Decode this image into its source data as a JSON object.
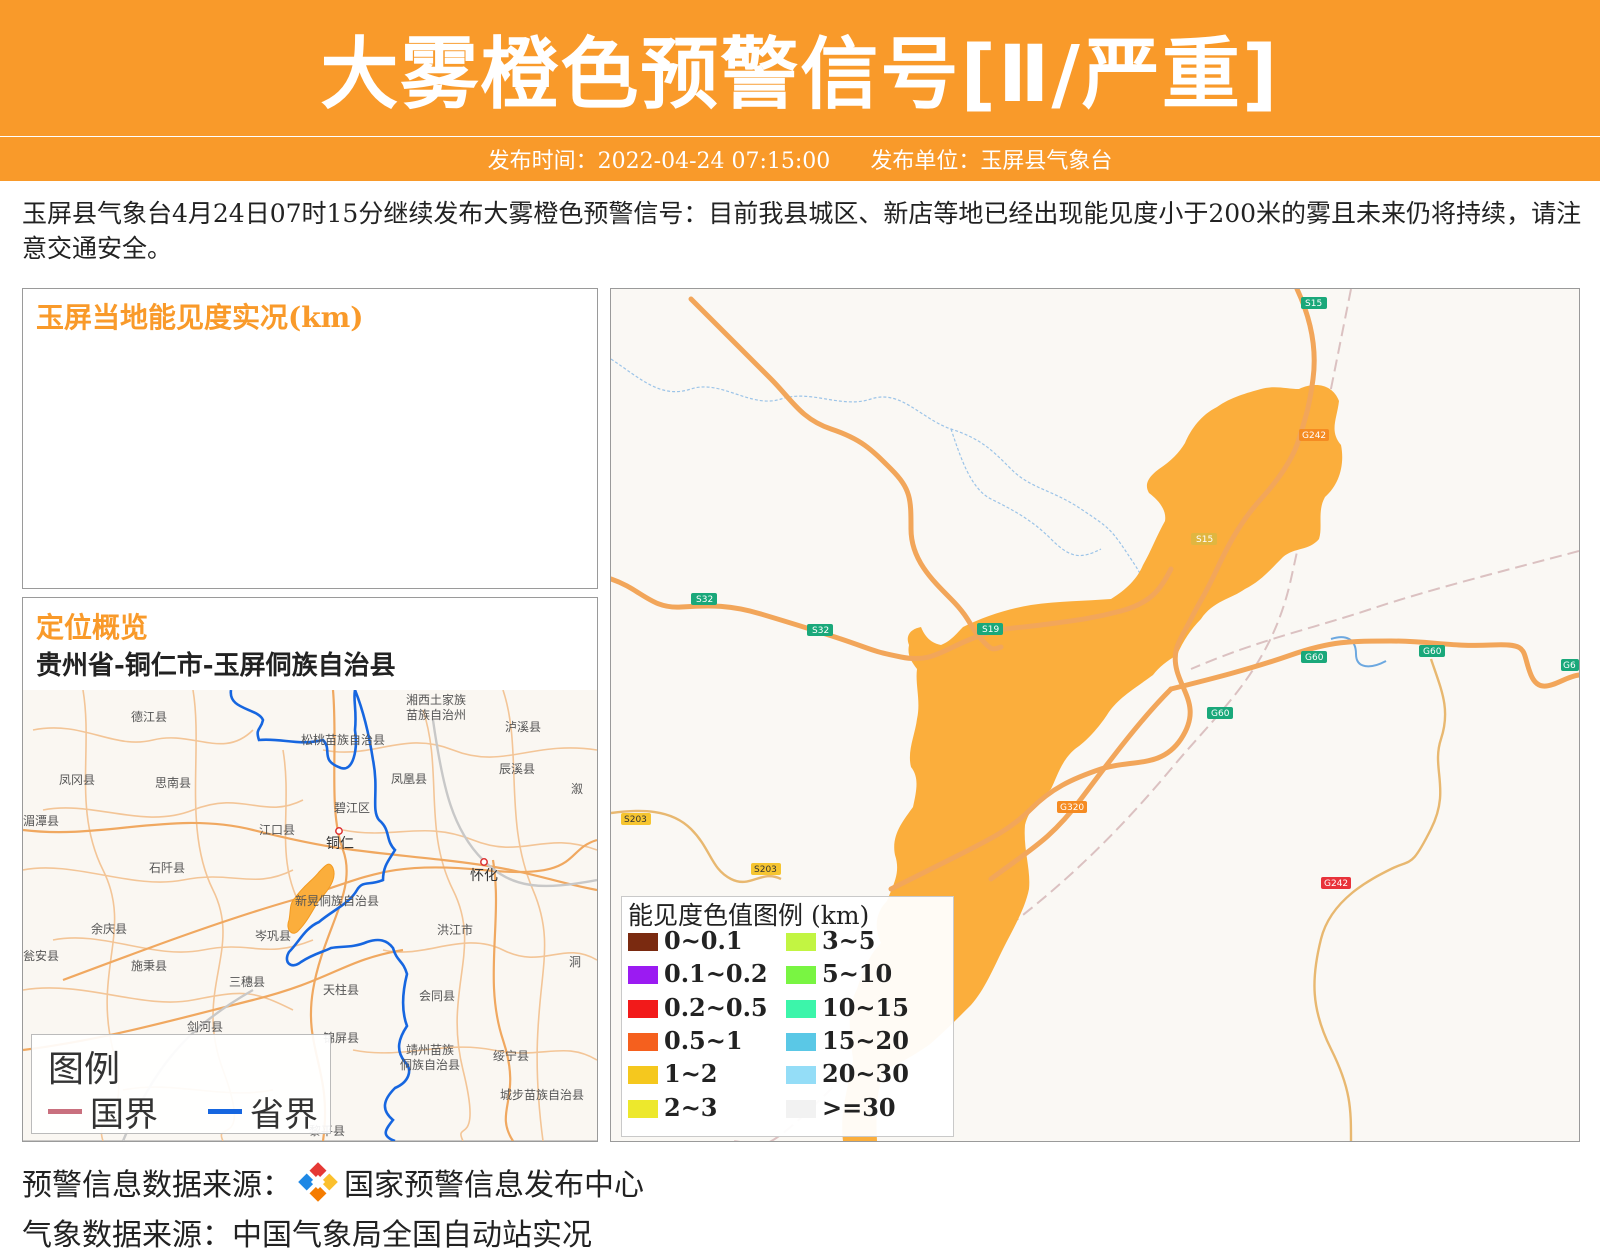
{
  "header": {
    "title": "大雾橙色预警信号[Ⅱ/严重]",
    "publish_time": "发布时间：2022-04-24 07:15:00",
    "publish_unit": "发布单位：玉屏县气象台",
    "banner_color": "#F99A2A"
  },
  "description": "玉屏县气象台4月24日07时15分继续发布大雾橙色预警信号：目前我县城区、新店等地已经出现能见度小于200米的雾且未来仍将持续，请注意交通安全。",
  "visibility_panel": {
    "title": "玉屏当地能见度实况(km)"
  },
  "location_panel": {
    "title": "定位概览",
    "location_name": "贵州省-铜仁市-玉屏侗族自治县",
    "place_labels": {
      "dejiang": "德江县",
      "xiangxi": "湘西土家族",
      "xiangxi2": "苗族自治州",
      "luxi": "泸溪县",
      "songtao": "松桃苗族自治县",
      "fenggang": "凤冈县",
      "sinan": "思南县",
      "fenghuang": "凤凰县",
      "chenxi": "辰溪县",
      "meitan": "湄潭县",
      "bijiang": "碧江区",
      "jiangkou": "江口县",
      "tongren": "铜仁",
      "huaihua": "怀化",
      "shiqian": "石阡县",
      "xinhuang": "新晃侗族自治县",
      "yuqing": "余庆县",
      "cengong": "岑巩县",
      "hongjiang": "洪江市",
      "wengan": "瓮安县",
      "shibing": "施秉县",
      "sansui": "三穗县",
      "tianzhu": "天柱县",
      "huitong": "会同县",
      "jianhe": "剑河县",
      "jinping": "锦屏县",
      "jingzhou": "靖州苗族",
      "jingzhou2": "侗族自治县",
      "suining": "绥宁县",
      "chengbu": "城步苗族自治县",
      "liping": "黎平县",
      "xu": "溆",
      "dong": "洞"
    },
    "legend": {
      "title": "图例",
      "national_border": "国界",
      "provincial_border": "省界",
      "national_color": "#C9707E",
      "provincial_color": "#1666E0"
    }
  },
  "detail_map": {
    "fog_color": "#FBAE3C",
    "road_labels": {
      "s15_top": "S15",
      "g242_top": "G242",
      "s15_mid": "S15",
      "s32_a": "S32",
      "s32_b": "S32",
      "s19": "S19",
      "g60_a": "G60",
      "g60_b": "G60",
      "g60_c": "G60",
      "g6_edge": "G6",
      "s203_a": "S203",
      "s203_b": "S203",
      "g320": "G320",
      "g242_bottom": "G242"
    }
  },
  "visibility_legend": {
    "title": "能见度色值图例 (km)",
    "items": [
      {
        "label": "0~0.1",
        "color": "#7A2A10"
      },
      {
        "label": "3~5",
        "color": "#C2F542"
      },
      {
        "label": "0.1~0.2",
        "color": "#9B1BF2"
      },
      {
        "label": "5~10",
        "color": "#79F542"
      },
      {
        "label": "0.2~0.5",
        "color": "#F21A1A"
      },
      {
        "label": "10~15",
        "color": "#3CF5AA"
      },
      {
        "label": "0.5~1",
        "color": "#F5601E"
      },
      {
        "label": "15~20",
        "color": "#5AC8E6"
      },
      {
        "label": "1~2",
        "color": "#F5C81E"
      },
      {
        "label": "20~30",
        "color": "#94DDF7"
      },
      {
        "label": "2~3",
        "color": "#EDE82C"
      },
      {
        "label": ">=30",
        "color": "#F2F2F2"
      }
    ]
  },
  "sources": {
    "warning_source": "预警信息数据来源：",
    "warning_source_name": "国家预警信息发布中心",
    "weather_source": "气象数据来源：中国气象局全国自动站实况"
  }
}
